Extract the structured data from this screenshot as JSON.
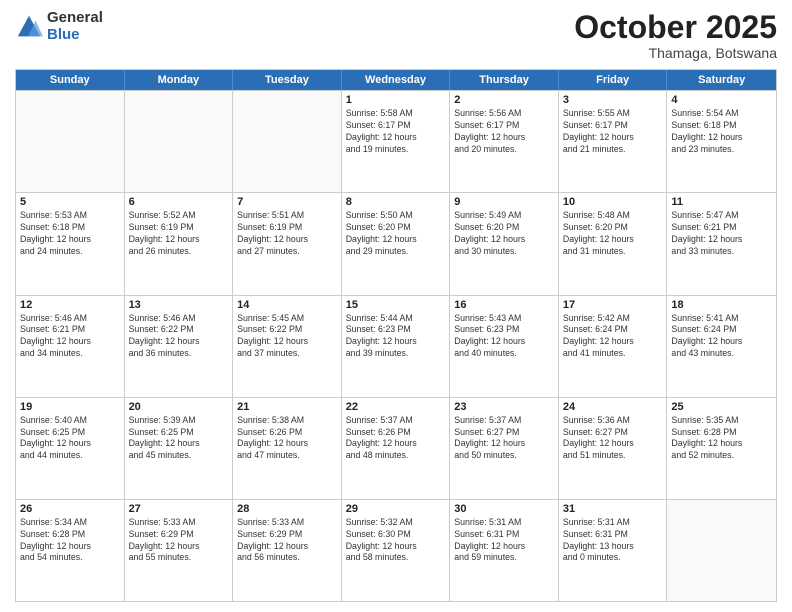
{
  "logo": {
    "general": "General",
    "blue": "Blue"
  },
  "header": {
    "month": "October 2025",
    "location": "Thamaga, Botswana"
  },
  "weekdays": [
    "Sunday",
    "Monday",
    "Tuesday",
    "Wednesday",
    "Thursday",
    "Friday",
    "Saturday"
  ],
  "weeks": [
    [
      {
        "day": "",
        "info": ""
      },
      {
        "day": "",
        "info": ""
      },
      {
        "day": "",
        "info": ""
      },
      {
        "day": "1",
        "info": "Sunrise: 5:58 AM\nSunset: 6:17 PM\nDaylight: 12 hours\nand 19 minutes."
      },
      {
        "day": "2",
        "info": "Sunrise: 5:56 AM\nSunset: 6:17 PM\nDaylight: 12 hours\nand 20 minutes."
      },
      {
        "day": "3",
        "info": "Sunrise: 5:55 AM\nSunset: 6:17 PM\nDaylight: 12 hours\nand 21 minutes."
      },
      {
        "day": "4",
        "info": "Sunrise: 5:54 AM\nSunset: 6:18 PM\nDaylight: 12 hours\nand 23 minutes."
      }
    ],
    [
      {
        "day": "5",
        "info": "Sunrise: 5:53 AM\nSunset: 6:18 PM\nDaylight: 12 hours\nand 24 minutes."
      },
      {
        "day": "6",
        "info": "Sunrise: 5:52 AM\nSunset: 6:19 PM\nDaylight: 12 hours\nand 26 minutes."
      },
      {
        "day": "7",
        "info": "Sunrise: 5:51 AM\nSunset: 6:19 PM\nDaylight: 12 hours\nand 27 minutes."
      },
      {
        "day": "8",
        "info": "Sunrise: 5:50 AM\nSunset: 6:20 PM\nDaylight: 12 hours\nand 29 minutes."
      },
      {
        "day": "9",
        "info": "Sunrise: 5:49 AM\nSunset: 6:20 PM\nDaylight: 12 hours\nand 30 minutes."
      },
      {
        "day": "10",
        "info": "Sunrise: 5:48 AM\nSunset: 6:20 PM\nDaylight: 12 hours\nand 31 minutes."
      },
      {
        "day": "11",
        "info": "Sunrise: 5:47 AM\nSunset: 6:21 PM\nDaylight: 12 hours\nand 33 minutes."
      }
    ],
    [
      {
        "day": "12",
        "info": "Sunrise: 5:46 AM\nSunset: 6:21 PM\nDaylight: 12 hours\nand 34 minutes."
      },
      {
        "day": "13",
        "info": "Sunrise: 5:46 AM\nSunset: 6:22 PM\nDaylight: 12 hours\nand 36 minutes."
      },
      {
        "day": "14",
        "info": "Sunrise: 5:45 AM\nSunset: 6:22 PM\nDaylight: 12 hours\nand 37 minutes."
      },
      {
        "day": "15",
        "info": "Sunrise: 5:44 AM\nSunset: 6:23 PM\nDaylight: 12 hours\nand 39 minutes."
      },
      {
        "day": "16",
        "info": "Sunrise: 5:43 AM\nSunset: 6:23 PM\nDaylight: 12 hours\nand 40 minutes."
      },
      {
        "day": "17",
        "info": "Sunrise: 5:42 AM\nSunset: 6:24 PM\nDaylight: 12 hours\nand 41 minutes."
      },
      {
        "day": "18",
        "info": "Sunrise: 5:41 AM\nSunset: 6:24 PM\nDaylight: 12 hours\nand 43 minutes."
      }
    ],
    [
      {
        "day": "19",
        "info": "Sunrise: 5:40 AM\nSunset: 6:25 PM\nDaylight: 12 hours\nand 44 minutes."
      },
      {
        "day": "20",
        "info": "Sunrise: 5:39 AM\nSunset: 6:25 PM\nDaylight: 12 hours\nand 45 minutes."
      },
      {
        "day": "21",
        "info": "Sunrise: 5:38 AM\nSunset: 6:26 PM\nDaylight: 12 hours\nand 47 minutes."
      },
      {
        "day": "22",
        "info": "Sunrise: 5:37 AM\nSunset: 6:26 PM\nDaylight: 12 hours\nand 48 minutes."
      },
      {
        "day": "23",
        "info": "Sunrise: 5:37 AM\nSunset: 6:27 PM\nDaylight: 12 hours\nand 50 minutes."
      },
      {
        "day": "24",
        "info": "Sunrise: 5:36 AM\nSunset: 6:27 PM\nDaylight: 12 hours\nand 51 minutes."
      },
      {
        "day": "25",
        "info": "Sunrise: 5:35 AM\nSunset: 6:28 PM\nDaylight: 12 hours\nand 52 minutes."
      }
    ],
    [
      {
        "day": "26",
        "info": "Sunrise: 5:34 AM\nSunset: 6:28 PM\nDaylight: 12 hours\nand 54 minutes."
      },
      {
        "day": "27",
        "info": "Sunrise: 5:33 AM\nSunset: 6:29 PM\nDaylight: 12 hours\nand 55 minutes."
      },
      {
        "day": "28",
        "info": "Sunrise: 5:33 AM\nSunset: 6:29 PM\nDaylight: 12 hours\nand 56 minutes."
      },
      {
        "day": "29",
        "info": "Sunrise: 5:32 AM\nSunset: 6:30 PM\nDaylight: 12 hours\nand 58 minutes."
      },
      {
        "day": "30",
        "info": "Sunrise: 5:31 AM\nSunset: 6:31 PM\nDaylight: 12 hours\nand 59 minutes."
      },
      {
        "day": "31",
        "info": "Sunrise: 5:31 AM\nSunset: 6:31 PM\nDaylight: 13 hours\nand 0 minutes."
      },
      {
        "day": "",
        "info": ""
      }
    ]
  ]
}
